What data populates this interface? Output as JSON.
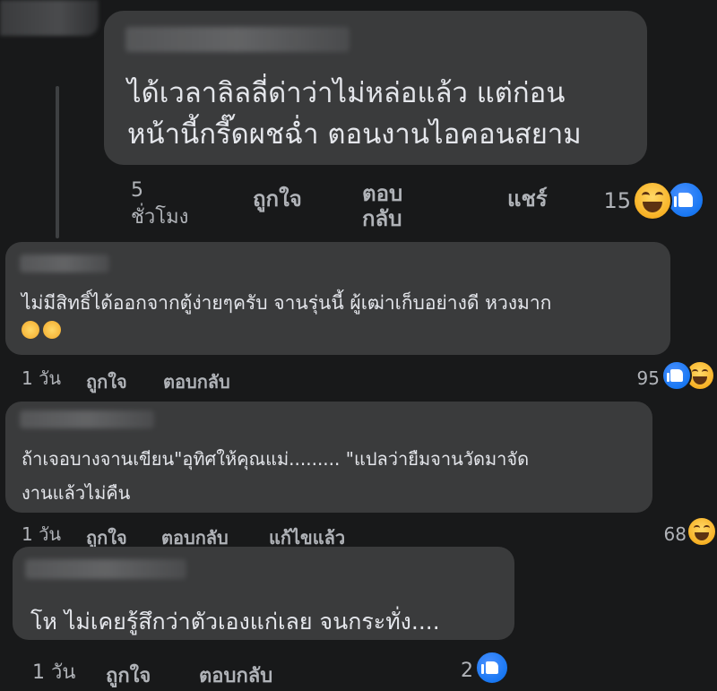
{
  "comments": [
    {
      "text_lines": [
        "ได้เวลาลิลลี่ด่าว่าไม่หล่อแล้ว แต่ก่อน",
        "หน้านี้กรี๊ดผชฉ่ำ ตอนงานไอคอนสยาม"
      ],
      "time": "5\nชั่วโมง",
      "like_label": "ถูกใจ",
      "reply_label": "ตอบ\nกลับ",
      "share_label": "แชร์",
      "reaction_count": "15",
      "reactions": [
        "haha-icon",
        "like-icon"
      ]
    },
    {
      "text_lines": [
        "ไม่มีสิทธิ์ได้ออกจากตู้ง่ายๆครับ จานรุ่นนี้ ผู้เฒ่าเก็บอย่างดี หวงมาก",
        "🤣🤣"
      ],
      "time": "1 วัน",
      "like_label": "ถูกใจ",
      "reply_label": "ตอบกลับ",
      "reaction_count": "95",
      "reactions": [
        "like-icon",
        "haha-icon"
      ]
    },
    {
      "text_lines": [
        "ถ้าเจอบางจานเขียน\"อุทิศให้คุณแม่......... \"แปลว่ายืมจานวัดมาจัด",
        "งานแล้วไม่คืน"
      ],
      "time": "1 วัน",
      "like_label": "ถูกใจ",
      "reply_label": "ตอบกลับ",
      "edited_label": "แก้ไขแล้ว",
      "reaction_count": "68",
      "reactions": [
        "haha-icon"
      ]
    },
    {
      "text_lines": [
        "โห ไม่เคยรู้สึกว่าตัวเองแก่เลย จนกระทั่ง...."
      ],
      "time": "1 วัน",
      "like_label": "ถูกใจ",
      "reply_label": "ตอบกลับ",
      "reaction_count": "2",
      "reactions": [
        "like-icon"
      ]
    }
  ],
  "colors": {
    "background": "#18191a",
    "bubble": "#3a3b3c",
    "text": "#e4e6eb",
    "meta": "#b0b3b8",
    "like_blue": "#1877f2",
    "haha_yellow": "#f7b125"
  }
}
